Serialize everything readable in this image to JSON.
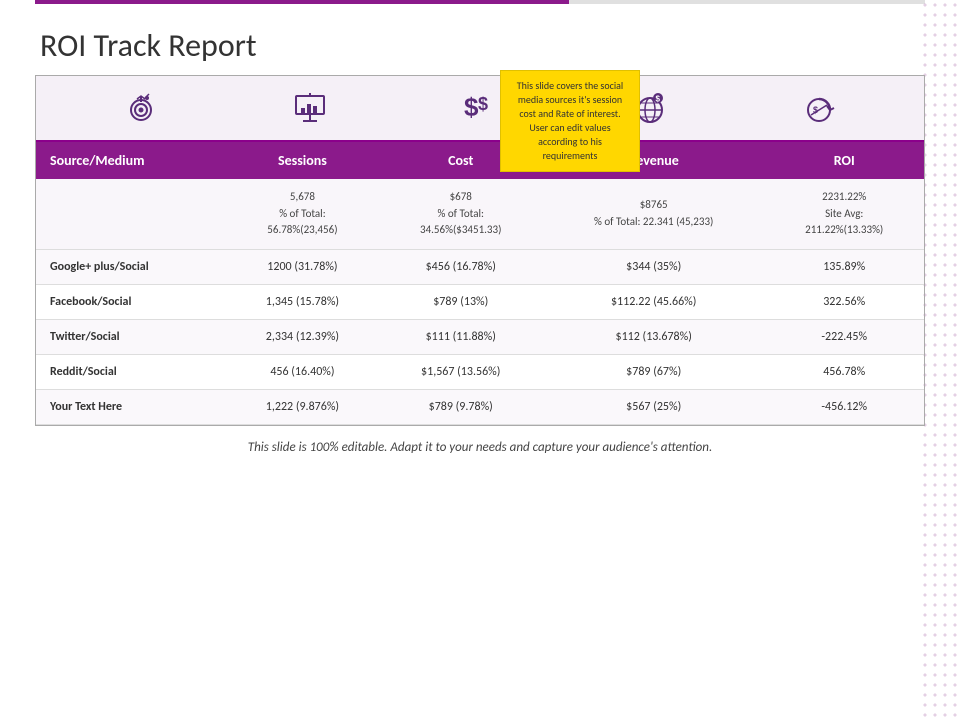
{
  "page": {
    "title": "ROI Track Report",
    "footer": "This slide is 100% editable. Adapt it to your needs and capture your audience's attention."
  },
  "tooltip": {
    "text": "This slide covers the social media sources it's session cost and Rate of interest. User can edit values according to his requirements"
  },
  "icons": [
    {
      "name": "target-icon",
      "label": "Target"
    },
    {
      "name": "presentation-icon",
      "label": "Presentation"
    },
    {
      "name": "dollar-icon",
      "label": "Dollar"
    },
    {
      "name": "globe-icon",
      "label": "Globe"
    },
    {
      "name": "refresh-icon",
      "label": "Refresh"
    }
  ],
  "table": {
    "headers": [
      "Source/Medium",
      "Sessions",
      "Cost",
      "Revenue",
      "ROI"
    ],
    "summary_row": {
      "sessions": "5,678\n% of Total:\n56.78%(23,456)",
      "cost": "$678\n% of Total:\n34.56%($3451.33)",
      "revenue": "$8765\n% of Total: 22.341 (45,233)",
      "roi": "2231.22%\nSite Avg:\n211.22%(13.33%)"
    },
    "rows": [
      {
        "source": "Google+ plus/Social",
        "sessions": "1200 (31.78%)",
        "cost": "$456 (16.78%)",
        "revenue": "$344 (35%)",
        "roi": "135.89%"
      },
      {
        "source": "Facebook/Social",
        "sessions": "1,345 (15.78%)",
        "cost": "$789 (13%)",
        "revenue": "$112.22 (45.66%)",
        "roi": "322.56%"
      },
      {
        "source": "Twitter/Social",
        "sessions": "2,334 (12.39%)",
        "cost": "$111 (11.88%)",
        "revenue": "$112 (13.678%)",
        "roi": "-222.45%"
      },
      {
        "source": "Reddit/Social",
        "sessions": "456 (16.40%)",
        "cost": "$1,567 (13.56%)",
        "revenue": "$789 (67%)",
        "roi": "456.78%"
      },
      {
        "source": "Your Text Here",
        "sessions": "1,222 (9.876%)",
        "cost": "$789 (9.78%)",
        "revenue": "$567 (25%)",
        "roi": "-456.12%"
      }
    ]
  }
}
